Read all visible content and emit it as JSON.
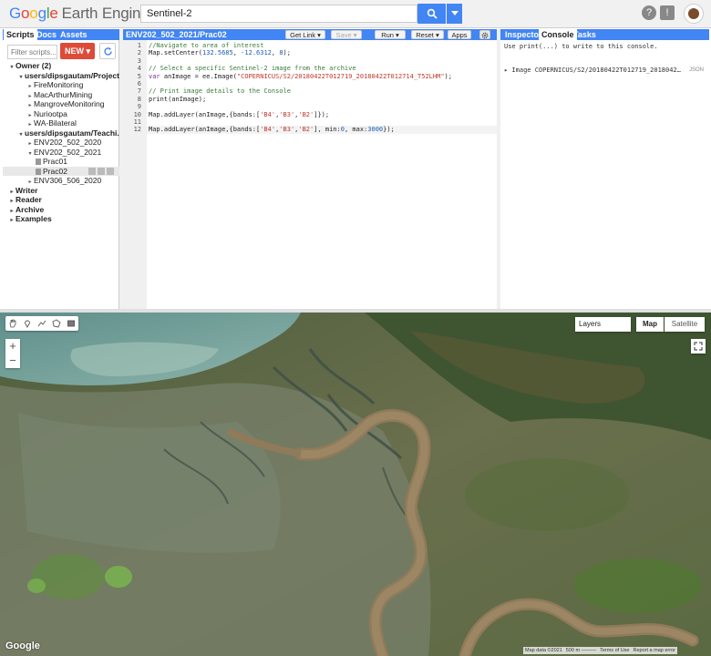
{
  "header": {
    "logo_google": [
      "G",
      "o",
      "o",
      "g",
      "l",
      "e"
    ],
    "logo_product": "Earth Engine",
    "search_value": "Sentinel-2"
  },
  "left_panel": {
    "tabs": [
      "Scripts",
      "Docs",
      "Assets"
    ],
    "filter_placeholder": "Filter scripts...",
    "new_label": "NEW ▾",
    "tree": [
      {
        "label": "Owner (2)",
        "indent": 0,
        "arrow": "▾",
        "bold": true
      },
      {
        "label": "users/dipsgautam/Projects",
        "indent": 1,
        "arrow": "▾",
        "bold": true
      },
      {
        "label": "FireMonitoring",
        "indent": 2,
        "arrow": "▸"
      },
      {
        "label": "MacArthurMining",
        "indent": 2,
        "arrow": "▸"
      },
      {
        "label": "MangroveMonitoring",
        "indent": 2,
        "arrow": "▸"
      },
      {
        "label": "Nuriootpa",
        "indent": 2,
        "arrow": "▸"
      },
      {
        "label": "WA-Bilateral",
        "indent": 2,
        "arrow": "▸"
      },
      {
        "label": "users/dipsgautam/Teachi...",
        "indent": 1,
        "arrow": "▾",
        "bold": true
      },
      {
        "label": "ENV202_502_2020",
        "indent": 2,
        "arrow": "▸"
      },
      {
        "label": "ENV202_502_2021",
        "indent": 2,
        "arrow": "▾"
      },
      {
        "label": "Prac01",
        "indent": 3,
        "file": true
      },
      {
        "label": "Prac02",
        "indent": 3,
        "file": true,
        "selected": true
      },
      {
        "label": "ENV306_506_2020",
        "indent": 2,
        "arrow": "▸"
      },
      {
        "label": "Writer",
        "indent": 0,
        "arrow": "▸",
        "bold": true
      },
      {
        "label": "Reader",
        "indent": 0,
        "arrow": "▸",
        "bold": true
      },
      {
        "label": "Archive",
        "indent": 0,
        "arrow": "▸",
        "bold": true
      },
      {
        "label": "Examples",
        "indent": 0,
        "arrow": "▸",
        "bold": true
      }
    ]
  },
  "editor": {
    "title": "ENV202_502_2021/Prac02",
    "buttons": {
      "get_link": "Get Link ▾",
      "save": "Save ▾",
      "run": "Run ▾",
      "reset": "Reset ▾",
      "apps": "Apps"
    },
    "lines": [
      [
        {
          "t": "//Navigate to area of interest",
          "c": "cm"
        }
      ],
      [
        {
          "t": "Map.setCenter(",
          "c": ""
        },
        {
          "t": "132.5685",
          "c": "num"
        },
        {
          "t": ", ",
          "c": ""
        },
        {
          "t": "-12.6312",
          "c": "num"
        },
        {
          "t": ", ",
          "c": ""
        },
        {
          "t": "8",
          "c": "num"
        },
        {
          "t": ");",
          "c": ""
        }
      ],
      [
        {
          "t": "",
          "c": ""
        }
      ],
      [
        {
          "t": "// Select a specific Sentinel-2 image from the archive",
          "c": "cm"
        }
      ],
      [
        {
          "t": "var",
          "c": "kw"
        },
        {
          "t": " anImage = ee.Image(",
          "c": ""
        },
        {
          "t": "\"COPERNICUS/S2/20180422T012719_20180422T012714_T52LHM\"",
          "c": "str"
        },
        {
          "t": ");",
          "c": ""
        }
      ],
      [
        {
          "t": "",
          "c": ""
        }
      ],
      [
        {
          "t": "// Print image details to the Console",
          "c": "cm"
        }
      ],
      [
        {
          "t": "print(anImage);",
          "c": ""
        }
      ],
      [
        {
          "t": "",
          "c": ""
        }
      ],
      [
        {
          "t": "Map.addLayer(anImage,{bands:[",
          "c": ""
        },
        {
          "t": "'B4'",
          "c": "str"
        },
        {
          "t": ",",
          "c": ""
        },
        {
          "t": "'B3'",
          "c": "str"
        },
        {
          "t": ",",
          "c": ""
        },
        {
          "t": "'B2'",
          "c": "str"
        },
        {
          "t": "]});",
          "c": ""
        }
      ],
      [
        {
          "t": "",
          "c": ""
        }
      ],
      [
        {
          "t": "Map.addLayer(anImage,{bands:[",
          "c": ""
        },
        {
          "t": "'B4'",
          "c": "str"
        },
        {
          "t": ",",
          "c": ""
        },
        {
          "t": "'B3'",
          "c": "str"
        },
        {
          "t": ",",
          "c": ""
        },
        {
          "t": "'B2'",
          "c": "str"
        },
        {
          "t": "], min:",
          "c": ""
        },
        {
          "t": "0",
          "c": "num"
        },
        {
          "t": ", max:",
          "c": ""
        },
        {
          "t": "3000",
          "c": "num"
        },
        {
          "t": "});",
          "c": ""
        }
      ]
    ]
  },
  "right_panel": {
    "tabs": [
      "Inspector",
      "Console",
      "Tasks"
    ],
    "console_hint": "Use print(...) to write to this console.",
    "console_entry": "▸ Image COPERNICUS/S2/20180422T012719_2018042…",
    "json_label": "JSON"
  },
  "map": {
    "layers_label": "Layers",
    "map_label": "Map",
    "satellite_label": "Satellite",
    "zoom_in": "+",
    "zoom_out": "−",
    "google_label": "Google",
    "attribution": [
      "Map data ©2021",
      "500 m ———",
      "Terms of Use",
      "Report a map error"
    ]
  }
}
